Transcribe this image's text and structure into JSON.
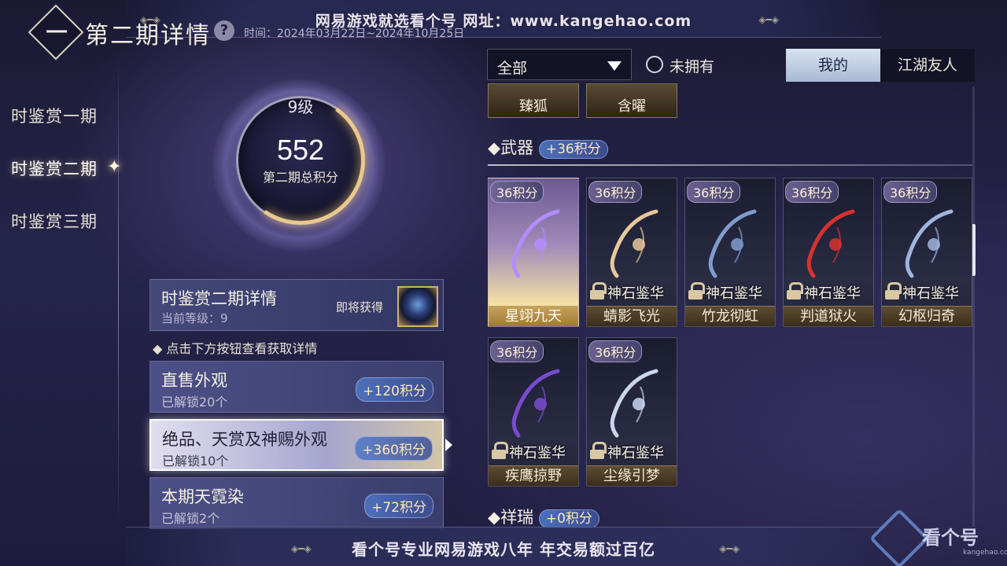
{
  "watermark_top": "网易游戏就选看个号   网址：www.kangehao.com",
  "watermark_bottom": "看个号专业网易游戏八年   年交易额过百亿",
  "corner_logo": {
    "text": "看个号",
    "url": "kangehao.com"
  },
  "header": {
    "title": "第二期详情",
    "help_icon": "?",
    "time": "时间：2024年03月22日~2024年10月25日"
  },
  "nav": {
    "items": [
      {
        "label": "时鉴赏一期",
        "active": false
      },
      {
        "label": "时鉴赏二期",
        "active": true
      },
      {
        "label": "时鉴赏三期",
        "active": false
      }
    ]
  },
  "level": {
    "label": "9级",
    "score": "552",
    "score_label": "第二期总积分"
  },
  "detail": {
    "title": "时鉴赏二期详情",
    "current_level": "当前等级：9",
    "soon_label": "即将获得"
  },
  "hint": "点击下方按钮查看获取详情",
  "categories": [
    {
      "name": "直售外观",
      "unlocked": "已解锁20个",
      "points": "+120积分",
      "active": false
    },
    {
      "name": "绝品、天赏及神赐外观",
      "unlocked": "已解锁10个",
      "points": "+360积分",
      "active": true
    },
    {
      "name": "本期天霓染",
      "unlocked": "已解锁2个",
      "points": "+72积分",
      "active": false
    }
  ],
  "filter": {
    "select_value": "全部",
    "unowned_label": "未拥有",
    "tabs": [
      {
        "label": "我的",
        "active": true
      },
      {
        "label": "江湖友人",
        "active": false
      }
    ]
  },
  "prev_items": [
    "臻狐",
    "含曜"
  ],
  "sections": [
    {
      "title": "武器",
      "points": "+36积分",
      "items": [
        {
          "badge": "36积分",
          "name": "星翊九天",
          "owned": true,
          "source": "",
          "color": "#b58cff"
        },
        {
          "badge": "36积分",
          "name": "蜻影飞光",
          "owned": false,
          "source": "神石鉴华",
          "color": "#e6c89a"
        },
        {
          "badge": "36积分",
          "name": "竹龙彻虹",
          "owned": false,
          "source": "神石鉴华",
          "color": "#7f9ccc"
        },
        {
          "badge": "36积分",
          "name": "判道狱火",
          "owned": false,
          "source": "神石鉴华",
          "color": "#d8322e"
        },
        {
          "badge": "36积分",
          "name": "幻枢归奇",
          "owned": false,
          "source": "神石鉴华",
          "color": "#9fb6dc"
        },
        {
          "badge": "36积分",
          "name": "疾鹰掠野",
          "owned": false,
          "source": "神石鉴华",
          "color": "#7a4bd0"
        },
        {
          "badge": "36积分",
          "name": "尘缘引梦",
          "owned": false,
          "source": "神石鉴华",
          "color": "#c9d6ee"
        }
      ]
    },
    {
      "title": "祥瑞",
      "points": "+0积分",
      "items": []
    }
  ]
}
